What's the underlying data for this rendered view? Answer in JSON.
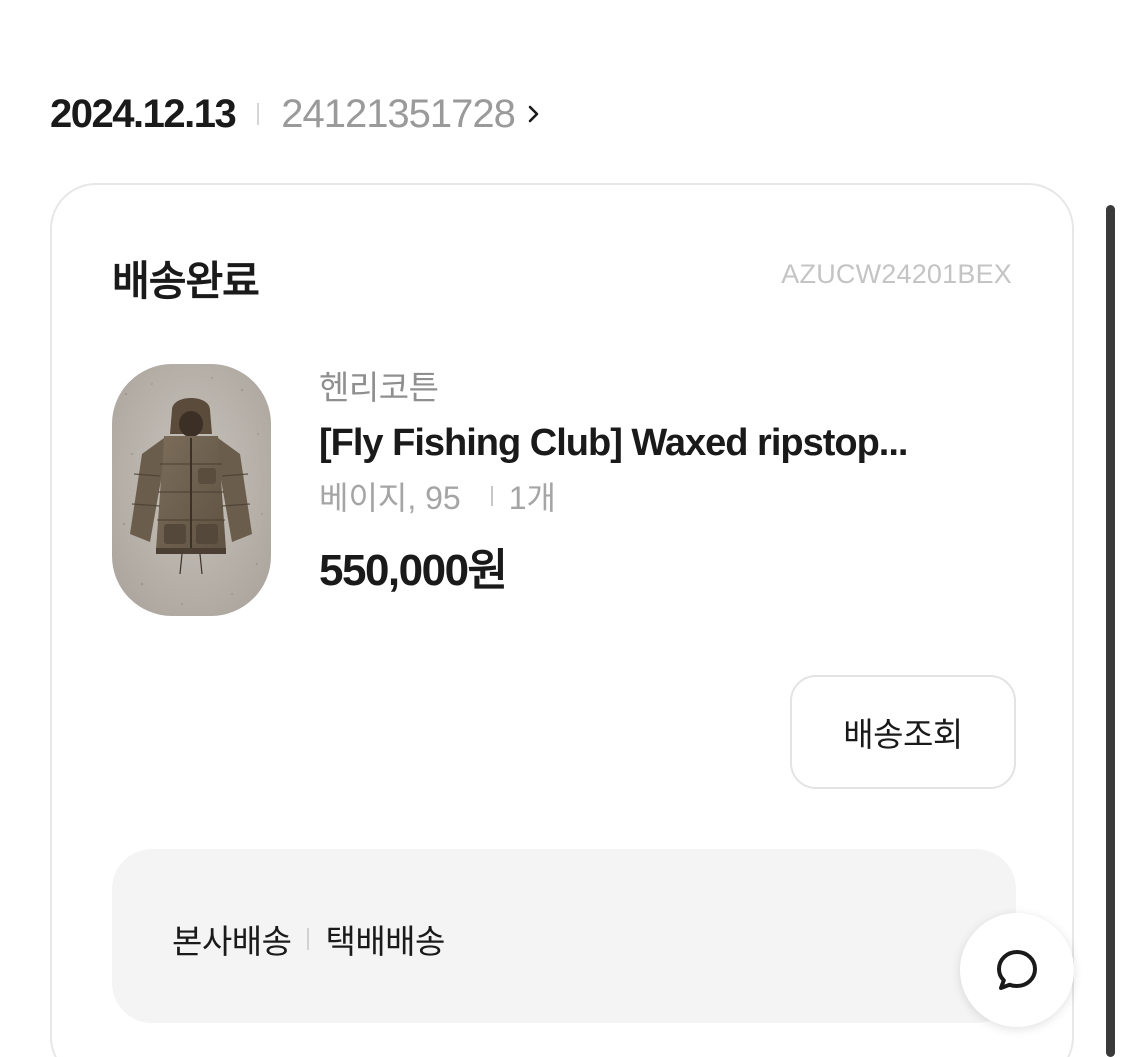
{
  "order": {
    "date": "2024.12.13",
    "number": "24121351728"
  },
  "card": {
    "status": "배송완료",
    "product_code": "AZUCW24201BEX",
    "product": {
      "brand": "헨리코튼",
      "name": "[Fly Fishing Club] Waxed ripstop...",
      "option": "베이지, 95",
      "quantity": "1개",
      "price": "550,000원",
      "image_alt": "Olive brown hooded puffer jacket"
    },
    "tracking_button_label": "배송조회",
    "delivery": {
      "method": "본사배송",
      "carrier": "택배배송"
    }
  },
  "icons": {
    "chevron": "chevron-right-icon",
    "chat": "chat-bubble-icon"
  },
  "colors": {
    "text_primary": "#1a1a1a",
    "text_secondary": "#9a9a9a",
    "card_border": "#e7e7e7",
    "delivery_bg": "#f4f4f4"
  }
}
